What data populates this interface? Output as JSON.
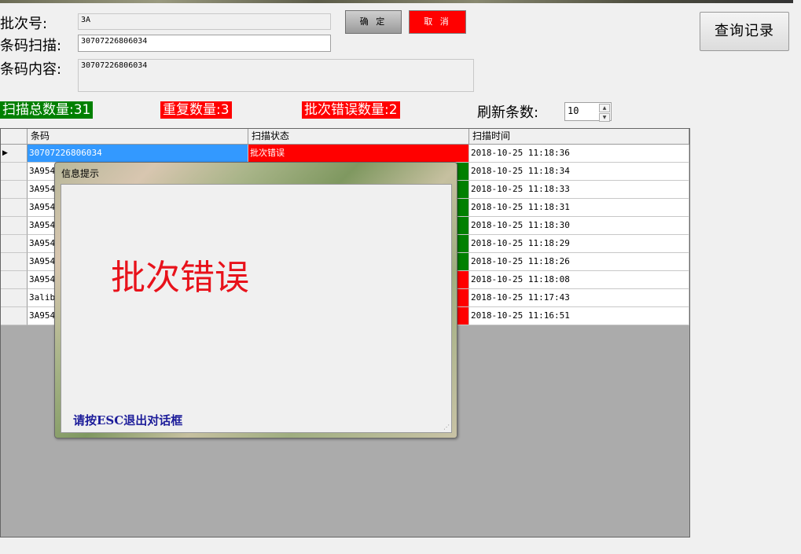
{
  "form": {
    "batch_label": "批次号:",
    "batch_value": "3A",
    "scan_label": "条码扫描:",
    "scan_value": "30707226806034",
    "content_label": "条码内容:",
    "content_value": "30707226806034"
  },
  "buttons": {
    "ok": "确 定",
    "cancel": "取 消",
    "query": "查询记录"
  },
  "stats": {
    "total": "扫描总数量:31",
    "duplicate": "重复数量:3",
    "batch_error": "批次错误数量:2",
    "refresh_label": "刷新条数:",
    "refresh_value": "10"
  },
  "table": {
    "headers": [
      "条码",
      "扫描状态",
      "扫描时间"
    ],
    "rows": [
      {
        "barcode": "30707226806034",
        "status": "批次错误",
        "time": "2018-10-25 11:18:36",
        "status_color": "red",
        "selected": true
      },
      {
        "barcode": "3A9541",
        "status": "",
        "time": "2018-10-25 11:18:34",
        "status_color": "green"
      },
      {
        "barcode": "3A9541",
        "status": "",
        "time": "2018-10-25 11:18:33",
        "status_color": "green"
      },
      {
        "barcode": "3A9541",
        "status": "",
        "time": "2018-10-25 11:18:31",
        "status_color": "green"
      },
      {
        "barcode": "3A9541",
        "status": "",
        "time": "2018-10-25 11:18:30",
        "status_color": "green"
      },
      {
        "barcode": "3A9541",
        "status": "",
        "time": "2018-10-25 11:18:29",
        "status_color": "green"
      },
      {
        "barcode": "3A9541",
        "status": "",
        "time": "2018-10-25 11:18:26",
        "status_color": "green"
      },
      {
        "barcode": "3A9541",
        "status": "",
        "time": "2018-10-25 11:18:08",
        "status_color": "red"
      },
      {
        "barcode": "3alib",
        "status": "",
        "time": "2018-10-25 11:17:43",
        "status_color": "red"
      },
      {
        "barcode": "3A9541",
        "status": "",
        "time": "2018-10-25 11:16:51",
        "status_color": "red"
      }
    ]
  },
  "dialog": {
    "title": "信息提示",
    "message": "批次错误",
    "hint": "请按ESC退出对话框"
  },
  "colors": {
    "error_red": "#ff0000",
    "ok_green": "#008000",
    "selection_blue": "#3399ff",
    "message_red": "#e8121b",
    "hint_blue": "#1d1d9a"
  }
}
